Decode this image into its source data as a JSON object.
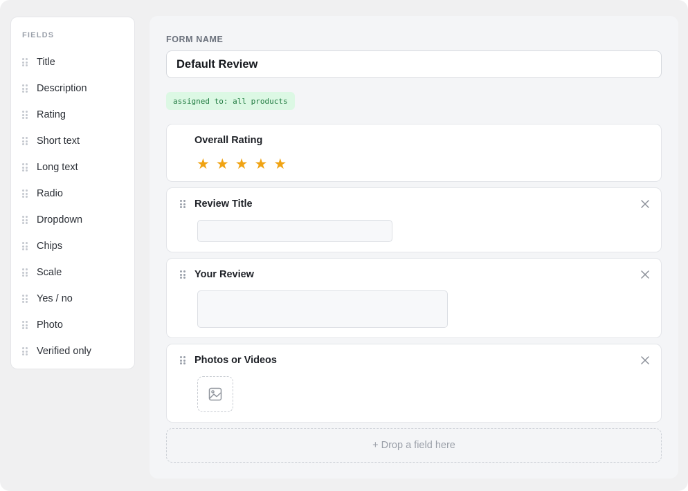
{
  "sidebar": {
    "title": "FIELDS",
    "items": [
      {
        "label": "Title"
      },
      {
        "label": "Description"
      },
      {
        "label": "Rating"
      },
      {
        "label": "Short text"
      },
      {
        "label": "Long text"
      },
      {
        "label": "Radio"
      },
      {
        "label": "Dropdown"
      },
      {
        "label": "Chips"
      },
      {
        "label": "Scale"
      },
      {
        "label": "Yes / no"
      },
      {
        "label": "Photo"
      },
      {
        "label": "Verified only"
      }
    ]
  },
  "form": {
    "name_label": "FORM NAME",
    "name_value": "Default Review",
    "assigned_badge": "assigned to: all products"
  },
  "fields": {
    "rating": {
      "title": "Overall Rating",
      "stars": 5,
      "star_icon": "star-icon",
      "star_color": "#f0a313"
    },
    "review_title": {
      "title": "Review Title",
      "input_value": ""
    },
    "your_review": {
      "title": "Your Review",
      "input_value": ""
    },
    "photos": {
      "title": "Photos or Videos",
      "icon": "image-icon"
    }
  },
  "dropzone": {
    "label": "+ Drop a field here"
  },
  "colors": {
    "accent_star": "#f0a313",
    "badge_bg": "#dcf8e4",
    "badge_text": "#1f7a3f"
  }
}
